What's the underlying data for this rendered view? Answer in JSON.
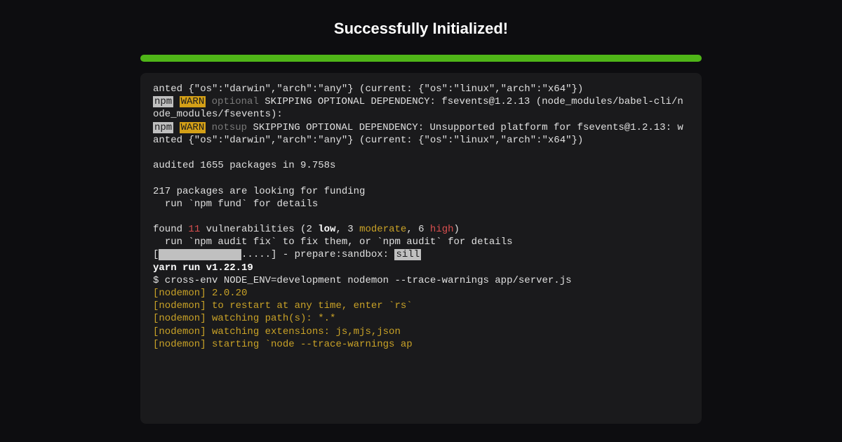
{
  "header": {
    "title": "Successfully Initialized!"
  },
  "terminal": {
    "line1": "anted {\"os\":\"darwin\",\"arch\":\"any\"} (current: {\"os\":\"linux\",\"arch\":\"x64\"})",
    "npm": "npm",
    "warn": "WARN",
    "optional": "optional",
    "skip1": "SKIPPING OPTIONAL DEPENDENCY: fsevents@1.2.13 (node_modules/babel-cli/node_modules/fsevents):",
    "notsup": "notsup",
    "skip2": "SKIPPING OPTIONAL DEPENDENCY: Unsupported platform for fsevents@1.2.13: wanted {\"os\":\"darwin\",\"arch\":\"any\"} (current: {\"os\":\"linux\",\"arch\":\"x64\"})",
    "audited": "audited 1655 packages in 9.758s",
    "funding1": "217 packages are looking for funding",
    "funding2": "  run `npm fund` for details",
    "found": "found ",
    "vuln_count": "11",
    "vuln_text1": " vulnerabilities (2 ",
    "low": "low",
    "vuln_text2": ", 3 ",
    "moderate": "moderate",
    "vuln_text3": ", 6 ",
    "high": "high",
    "vuln_text4": ")",
    "audit_fix": "  run `npm audit fix` to fix them, or `npm audit` for details",
    "progress_open": "[",
    "progress_filled": "              ",
    "progress_dots": ".....",
    "progress_close": "] - prepare:sandbox: ",
    "sill": "sill",
    "yarn": "yarn run v1.22.19",
    "cmd": "$ cross-env NODE_ENV=development nodemon --trace-warnings app/server.js",
    "nodemon1": "[nodemon] 2.0.20",
    "nodemon2": "[nodemon] to restart at any time, enter `rs`",
    "nodemon3": "[nodemon] watching path(s): *.*",
    "nodemon4": "[nodemon] watching extensions: js,mjs,json",
    "nodemon5": "[nodemon] starting `node --trace-warnings ap"
  }
}
